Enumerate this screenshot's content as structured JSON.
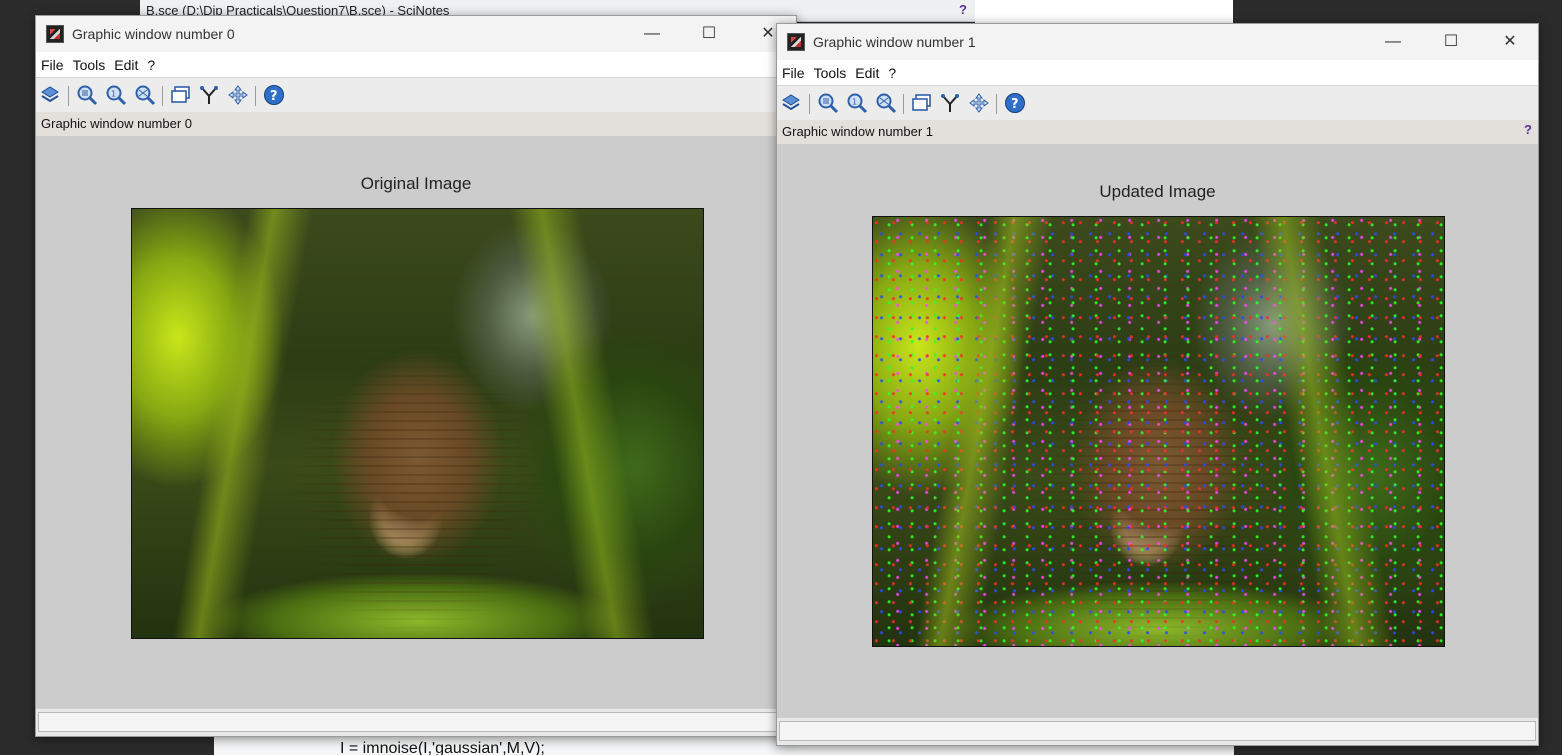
{
  "background_editor": {
    "title": "B.sce (D:\\Dip Practicals\\Question7\\B.sce) - SciNotes",
    "help_mark": "?",
    "code_line": "I = imnoise(I,'gaussian',M,V);"
  },
  "windows": [
    {
      "title": "Graphic window number 0",
      "menu": [
        "File",
        "Tools",
        "Edit",
        "?"
      ],
      "info_text": "Graphic window number 0",
      "info_help": "",
      "plot_title": "Original Image",
      "minimize": "—",
      "maximize": "☐",
      "close": "✕"
    },
    {
      "title": "Graphic window number 1",
      "menu": [
        "File",
        "Tools",
        "Edit",
        "?"
      ],
      "info_text": "Graphic window number 1",
      "info_help": "?",
      "plot_title": "Updated Image",
      "minimize": "—",
      "maximize": "☐",
      "close": "✕"
    }
  ],
  "toolbar_icons": [
    "rotate-icon",
    "zoom-in-icon",
    "zoom-reset-icon",
    "zoom-out-icon",
    "datatip-icon",
    "edit-datatips-icon",
    "pan-icon",
    "help-icon"
  ],
  "colors": {
    "window_bg": "#cccccc",
    "help_accent": "#553399",
    "icon_blue": "#2f5fa8"
  }
}
